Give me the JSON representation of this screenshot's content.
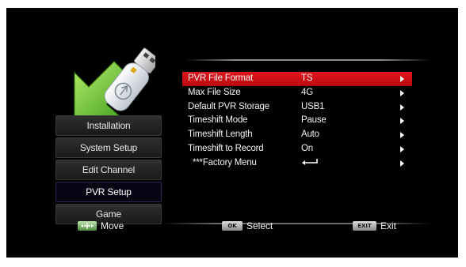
{
  "menu": {
    "items": [
      {
        "label": "Installation",
        "active": false
      },
      {
        "label": "System Setup",
        "active": false
      },
      {
        "label": "Edit Channel",
        "active": false
      },
      {
        "label": "PVR Setup",
        "active": true
      },
      {
        "label": "Game",
        "active": false
      }
    ]
  },
  "settings": {
    "rows": [
      {
        "label": "PVR File Format",
        "value": "TS"
      },
      {
        "label": "Max File Size",
        "value": "4G"
      },
      {
        "label": "Default PVR Storage",
        "value": "USB1"
      },
      {
        "label": "Timeshift Mode",
        "value": "Pause"
      },
      {
        "label": "Timeshift Length",
        "value": "Auto"
      },
      {
        "label": "Timeshift to Record",
        "value": "On"
      },
      {
        "label": "***Factory Menu",
        "value": "enter-icon"
      }
    ],
    "selected_index": 0
  },
  "footer": {
    "move_label": "Move",
    "select_key": "OK",
    "select_label": "Select",
    "exit_key": "EXIT",
    "exit_label": "Exit"
  },
  "icons": {
    "header": "usb-download-icon",
    "move_key": "dpad-icon",
    "row_arrow": "right-triangle-icon"
  },
  "colors": {
    "background": "#000000",
    "selected_row": "#d0121a",
    "arrow_green": "#6cc83a",
    "text": "#f2f2f2"
  }
}
